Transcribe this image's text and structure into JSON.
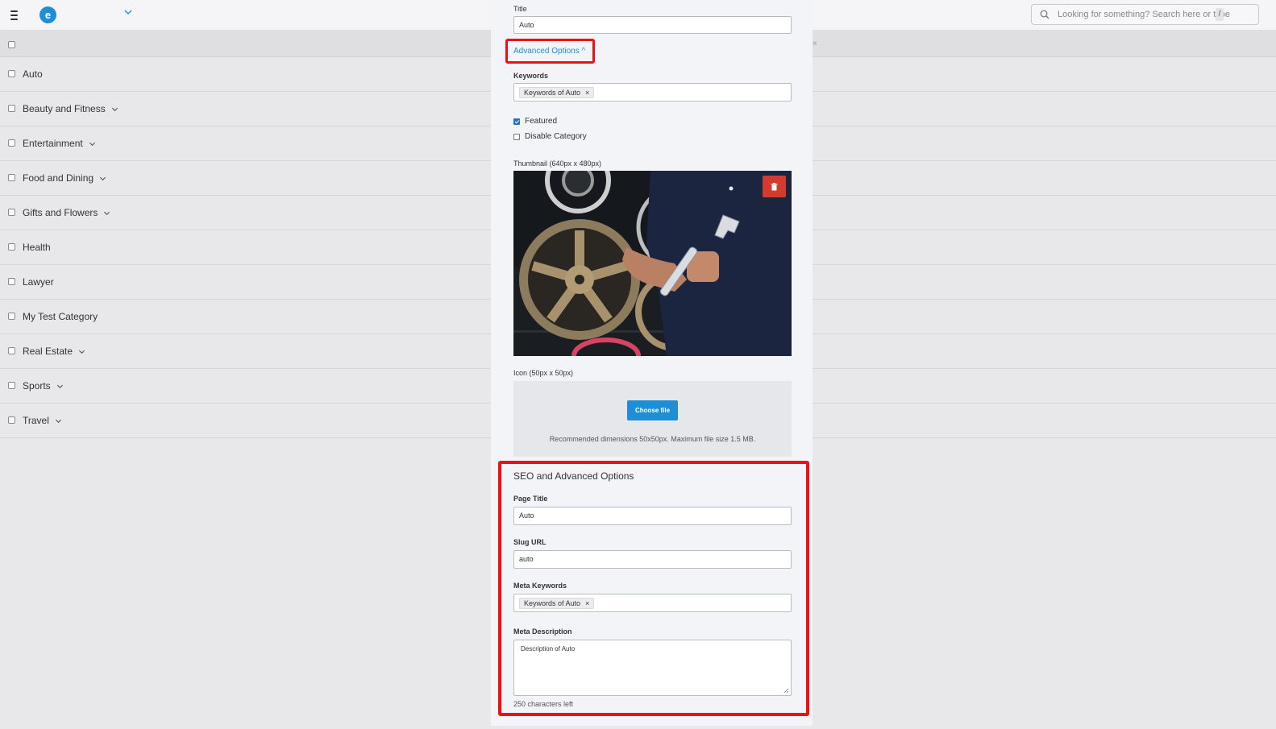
{
  "topbar": {
    "logo_letter": "e",
    "search_placeholder": "Looking for something? Search here or type",
    "search_shortcut": "/"
  },
  "header": {
    "close_symbol": "×"
  },
  "categories": [
    {
      "label": "Auto",
      "has_children": false
    },
    {
      "label": "Beauty and Fitness",
      "has_children": true
    },
    {
      "label": "Entertainment",
      "has_children": true
    },
    {
      "label": "Food and Dining",
      "has_children": true
    },
    {
      "label": "Gifts and Flowers",
      "has_children": true
    },
    {
      "label": "Health",
      "has_children": false
    },
    {
      "label": "Lawyer",
      "has_children": false
    },
    {
      "label": "My Test Category",
      "has_children": false
    },
    {
      "label": "Real Estate",
      "has_children": true
    },
    {
      "label": "Sports",
      "has_children": true
    },
    {
      "label": "Travel",
      "has_children": true
    }
  ],
  "form": {
    "title_label": "Title",
    "title_value": "Auto",
    "advanced_toggle": "Advanced Options ^",
    "keywords_label": "Keywords",
    "keywords_tag": "Keywords of Auto",
    "tag_remove": "×",
    "featured_label": "Featured",
    "featured_checked": true,
    "disable_label": "Disable Category",
    "disable_checked": false,
    "thumbnail_label": "Thumbnail (640px x 480px)",
    "icon_label": "Icon (50px x 50px)",
    "choose_file": "Choose file",
    "dropzone_note": "Recommended dimensions 50x50px. Maximum file size 1.5 MB."
  },
  "seo": {
    "heading": "SEO and Advanced Options",
    "page_title_label": "Page Title",
    "page_title_value": "Auto",
    "slug_label": "Slug URL",
    "slug_value": "auto",
    "meta_keywords_label": "Meta Keywords",
    "meta_keywords_tag": "Keywords of Auto",
    "meta_description_label": "Meta Description",
    "meta_description_value": "Description of Auto",
    "chars_left": "250 characters left"
  },
  "colors": {
    "accent": "#1e8fd6",
    "highlight": "#ee1111",
    "delete": "#d13c2f"
  },
  "icons": [
    "hamburger-icon",
    "logo-icon",
    "chevron-down-icon",
    "search-icon",
    "trash-icon",
    "close-icon",
    "resize-handle-icon"
  ]
}
